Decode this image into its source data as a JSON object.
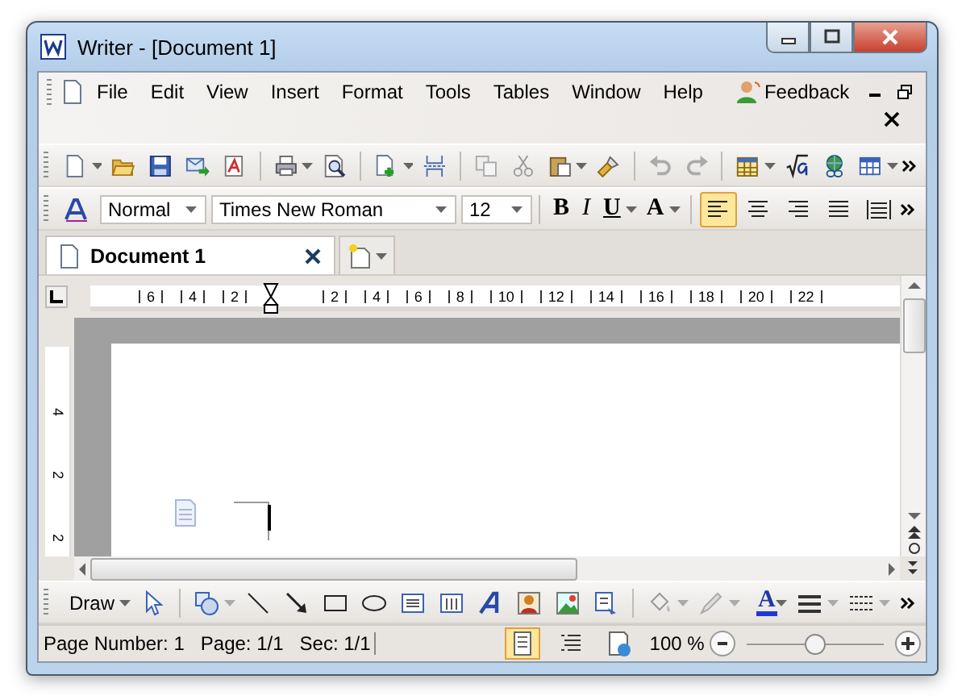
{
  "window": {
    "title": "Writer - [Document 1]"
  },
  "menu": {
    "items": [
      "File",
      "Edit",
      "View",
      "Insert",
      "Format",
      "Tools",
      "Tables",
      "Window",
      "Help"
    ],
    "feedback": "Feedback"
  },
  "format_bar": {
    "style": "Normal",
    "font": "Times New Roman",
    "size": "12",
    "text_buttons": [
      "B",
      "I",
      "U",
      "A"
    ],
    "alignments": [
      {
        "selected": true
      },
      {
        "selected": false
      },
      {
        "selected": false
      },
      {
        "selected": false
      },
      {
        "selected": false
      }
    ]
  },
  "tabs": [
    {
      "label": "Document 1",
      "selected": true
    }
  ],
  "ruler": {
    "labels": [
      "6",
      "4",
      "2",
      "2",
      "4",
      "6",
      "8",
      "10",
      "12",
      "14",
      "16",
      "18",
      "20",
      "22"
    ],
    "vertical_labels": [
      "4",
      "2",
      "2"
    ]
  },
  "draw_toolbar": {
    "label": "Draw",
    "font_color_label": "A"
  },
  "status_bar": {
    "page_number": "Page Number: 1",
    "page": "Page: 1/1",
    "section": "Sec: 1/1",
    "zoom": "100 %",
    "views": [
      {
        "selected": true
      },
      {
        "selected": false
      },
      {
        "selected": false
      }
    ],
    "zoom_slider": {
      "level": 0.5
    }
  }
}
